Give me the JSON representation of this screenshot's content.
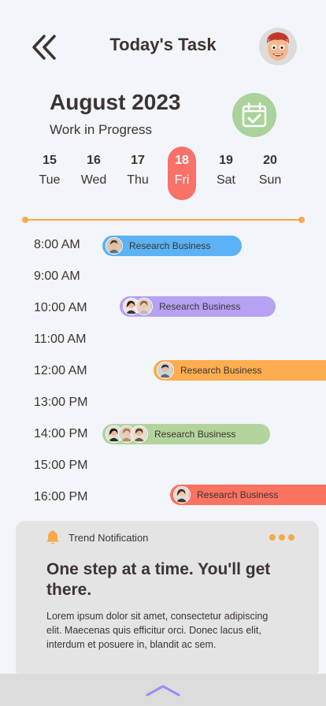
{
  "header": {
    "title": "Today's Task",
    "back_icon": "double-chevron-left-icon",
    "avatar_icon": "cartoon-avatar-icon"
  },
  "calendar": {
    "month": "August 2023",
    "status": "Work in Progress",
    "calendar_icon": "calendar-check-icon",
    "days": [
      {
        "num": "15",
        "name": "Tue"
      },
      {
        "num": "16",
        "name": "Wed"
      },
      {
        "num": "17",
        "name": "Thu"
      },
      {
        "num": "18",
        "name": "Fri",
        "active": true
      },
      {
        "num": "19",
        "name": "Sat"
      },
      {
        "num": "20",
        "name": "Sun"
      }
    ]
  },
  "timeline": {
    "times": [
      "8:00 AM",
      "9:00 AM",
      "10:00 AM",
      "11:00 AM",
      "12:00 AM",
      "13:00 PM",
      "14:00 PM",
      "15:00 PM",
      "16:00 PM"
    ],
    "tasks": [
      {
        "label": "Research Business",
        "color": "#5bb2f5",
        "people": 1
      },
      {
        "label": "Research Business",
        "color": "#b6a2f3",
        "people": 2
      },
      {
        "label": "Research Business",
        "color": "#fbad4f",
        "people": 1
      },
      {
        "label": "Research Business",
        "color": "#b3d59d",
        "people": 3
      },
      {
        "label": "Research Business",
        "color": "#fa7262",
        "people": 1
      }
    ]
  },
  "notification": {
    "icon": "bell-icon",
    "title": "Trend Notification",
    "more_icon": "more-dots-icon",
    "headline": "One step at a time. You'll get there.",
    "body": "Lorem ipsum dolor sit amet, consectetur adipiscing elit. Maecenas quis efficitur orci. Donec lacus elit, interdum et posuere in, blandit ac sem."
  },
  "bottom": {
    "icon": "chevron-up-icon"
  },
  "colors": {
    "accent_orange": "#f6a94a",
    "active_day": "#f87268",
    "calendar_green": "#a9d39a",
    "chevron_purple": "#9b8df0"
  }
}
